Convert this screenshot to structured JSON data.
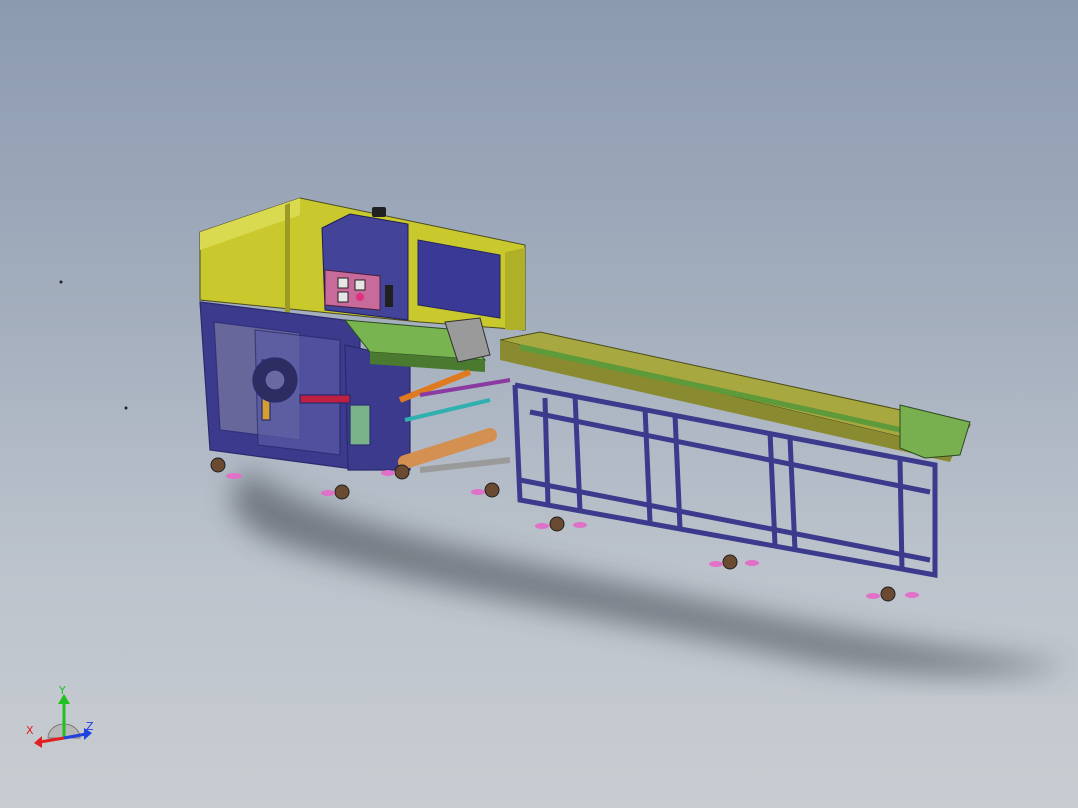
{
  "viewer": {
    "triad": {
      "x_label": "X",
      "y_label": "Y",
      "z_label": "Z",
      "x_color": "#e02020",
      "y_color": "#20c020",
      "z_color": "#2040e0"
    }
  },
  "model": {
    "colors": {
      "background_top": "#8c9ab0",
      "background_bottom": "#c9cdd2",
      "housing_yellow": "#c9c92e",
      "frame_navy": "#3b3a8c",
      "conveyor_olive": "#a8a840",
      "conveyor_green": "#5f9a3a",
      "cabinet_blue": "#43439a",
      "panel_pink": "#c86a9a",
      "caster_pink": "#e070c8",
      "roller_orange": "#d49050",
      "shadow": "#3a3f48"
    },
    "icons": [
      "axis-triad-icon",
      "caster-wheel-icon"
    ]
  }
}
